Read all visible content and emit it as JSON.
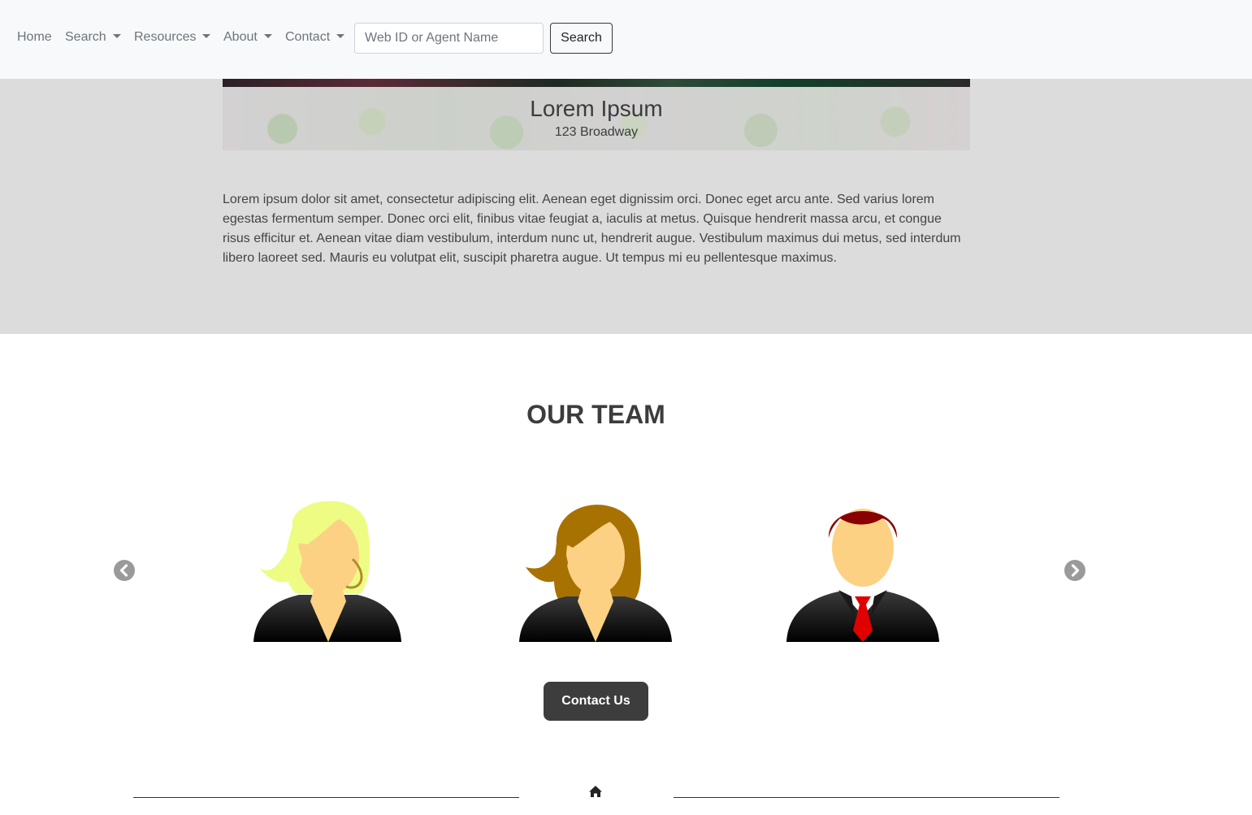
{
  "navbar": {
    "items": [
      {
        "label": "Home",
        "dropdown": false
      },
      {
        "label": "Search",
        "dropdown": true
      },
      {
        "label": "Resources",
        "dropdown": true
      },
      {
        "label": "About",
        "dropdown": true
      },
      {
        "label": "Contact",
        "dropdown": true
      }
    ],
    "search": {
      "placeholder": "Web ID or Agent Name",
      "value": "",
      "button_label": "Search"
    }
  },
  "hero": {
    "title": "Lorem Ipsum",
    "address": "123 Broadway",
    "description": "Lorem ipsum dolor sit amet, consectetur adipiscing elit. Aenean eget dignissim orci. Donec eget arcu ante. Sed varius lorem egestas fermentum semper. Donec orci elit, finibus vitae feugiat a, iaculis at metus. Quisque hendrerit massa arcu, et congue risus efficitur et. Aenean vitae diam vestibulum, interdum nunc ut, hendrerit augue. Vestibulum maximus dui metus, sed interdum libero laoreet sed. Mauris eu volutpat elit, suscipit pharetra augue. Ut tempus mi eu pellentesque maximus."
  },
  "team": {
    "title": "OUR TEAM",
    "members": [
      {
        "avatar": "female-avatar-blonde-icon"
      },
      {
        "avatar": "female-avatar-brunette-icon"
      },
      {
        "avatar": "male-avatar-red-hair-icon"
      }
    ],
    "prev_icon": "chevron-left-circle-icon",
    "next_icon": "chevron-right-circle-icon",
    "contact_button": "Contact Us"
  },
  "footer": {
    "icon": "home-icon"
  },
  "colors": {
    "navbar_bg": "#f8f9fa",
    "hero_bg": "#dcdcdc",
    "contact_button_bg": "#3d3d3d",
    "tie_red": "#e00000"
  }
}
